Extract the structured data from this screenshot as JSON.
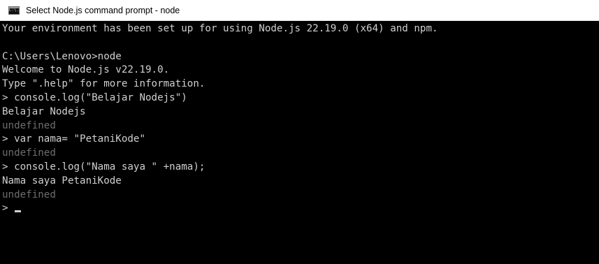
{
  "window": {
    "title": "Select Node.js command prompt - node",
    "icon": "cmd-console-icon",
    "icon_text": "C:\\."
  },
  "console": {
    "text_color": "#d0d0d0",
    "dim_color": "#6e6e6e",
    "background": "#000000",
    "lines": [
      {
        "text": "Your environment has been set up for using Node.js 22.19.0 (x64) and npm.",
        "dim": false
      },
      {
        "text": "",
        "dim": false
      },
      {
        "text": "C:\\Users\\Lenovo>node",
        "dim": false
      },
      {
        "text": "Welcome to Node.js v22.19.0.",
        "dim": false
      },
      {
        "text": "Type \".help\" for more information.",
        "dim": false
      },
      {
        "text": "> console.log(\"Belajar Nodejs\")",
        "dim": false
      },
      {
        "text": "Belajar Nodejs",
        "dim": false
      },
      {
        "text": "undefined",
        "dim": true
      },
      {
        "text": "> var nama= \"PetaniKode\"",
        "dim": false
      },
      {
        "text": "undefined",
        "dim": true
      },
      {
        "text": "> console.log(\"Nama saya \" +nama);",
        "dim": false
      },
      {
        "text": "Nama saya PetaniKode",
        "dim": false
      },
      {
        "text": "undefined",
        "dim": true
      }
    ],
    "prompt": "> "
  }
}
